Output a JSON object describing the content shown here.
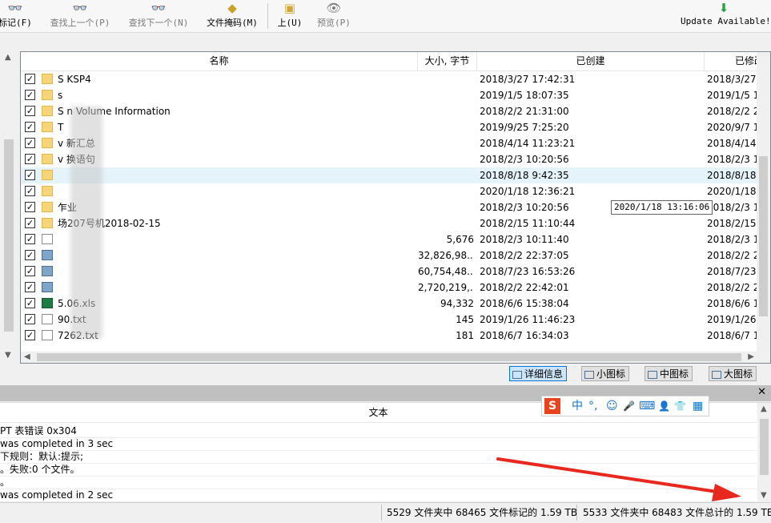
{
  "toolbar": {
    "buttons": [
      {
        "label": "标记(F)",
        "icon": "binoculars-icon"
      },
      {
        "label": "查找上一个(P)",
        "icon": "binoculars-up-icon"
      },
      {
        "label": "查找下一个(N)",
        "icon": "binoculars-down-icon"
      },
      {
        "label": "文件掩码(M)",
        "icon": "file-mask-icon"
      },
      {
        "label": "上(U)",
        "icon": "folder-up-icon"
      },
      {
        "label": "预览(P)",
        "icon": "eye-icon"
      }
    ],
    "update_label": "Update Available!",
    "update_icon": "download-arrow-icon"
  },
  "filelist": {
    "columns": [
      "名称",
      "大小, 字节",
      "已创建",
      "已修改"
    ],
    "rows": [
      {
        "name": "S   KSP4",
        "size": "",
        "created": "2018/3/27 17:42:31",
        "modified": "2018/3/27",
        "type": "folder"
      },
      {
        "name": "s",
        "size": "",
        "created": "2019/1/5 18:07:35",
        "modified": "2019/1/5 1",
        "type": "folder"
      },
      {
        "name": "S      n Volume Information",
        "size": "",
        "created": "2018/2/2 21:31:00",
        "modified": "2018/2/2 2",
        "type": "folder"
      },
      {
        "name": "T",
        "size": "",
        "created": "2019/9/25 7:25:20",
        "modified": "2020/9/7 1",
        "type": "folder"
      },
      {
        "name": "v        新汇总",
        "size": "",
        "created": "2018/4/14 11:23:21",
        "modified": "2018/4/14",
        "type": "folder"
      },
      {
        "name": "v        换语句",
        "size": "",
        "created": "2018/2/3 10:20:56",
        "modified": "2018/2/3 1",
        "type": "folder"
      },
      {
        "name": "",
        "size": "",
        "created": "2018/8/18 9:42:35",
        "modified": "2018/8/18",
        "type": "folder",
        "selected": true
      },
      {
        "name": "",
        "size": "",
        "created": "2020/1/18 12:36:21",
        "modified": "2020/1/18",
        "type": "folder"
      },
      {
        "name": "         乍业",
        "size": "",
        "created": "2018/2/3 10:20:56",
        "modified": "2018/2/3 1",
        "type": "folder"
      },
      {
        "name": "       场207号机2018-02-15",
        "size": "",
        "created": "2018/2/15 11:10:44",
        "modified": "2018/2/15",
        "type": "folder"
      },
      {
        "name": "",
        "size": "5,676",
        "created": "2018/2/3 10:11:40",
        "modified": "2018/2/3 1",
        "type": "doc"
      },
      {
        "name": "",
        "size": "32,826,98...",
        "created": "2018/2/2 22:37:05",
        "modified": "2018/2/2 2",
        "type": "img"
      },
      {
        "name": "",
        "size": "60,754,48...",
        "created": "2018/7/23 16:53:26",
        "modified": "2018/7/23",
        "type": "img"
      },
      {
        "name": "",
        "size": "2,720,219,...",
        "created": "2018/2/2 22:42:01",
        "modified": "2018/2/2 2",
        "type": "img"
      },
      {
        "name": "       5.06.xls",
        "size": "94,332",
        "created": "2018/6/6 15:38:04",
        "modified": "2018/6/6 1",
        "type": "xls"
      },
      {
        "name": "     90.txt",
        "size": "145",
        "created": "2019/1/26 11:46:23",
        "modified": "2019/1/26",
        "type": "doc"
      },
      {
        "name": "7262.txt",
        "size": "181",
        "created": "2018/6/7 16:34:03",
        "modified": "2018/6/7 1",
        "type": "doc"
      }
    ],
    "tooltip": "2020/1/18 13:16:06"
  },
  "viewbuttons": [
    {
      "label": "详细信息",
      "active": true
    },
    {
      "label": "小图标",
      "active": false
    },
    {
      "label": "中图标",
      "active": false
    },
    {
      "label": "大图标",
      "active": false
    }
  ],
  "logpanel": {
    "header": "文本",
    "lines": [
      "PT 表错误 0x304",
      "was completed in 3 sec",
      "下规则：默认:提示;",
      "。失败:0 个文件。",
      "。",
      "was completed in 2 sec"
    ]
  },
  "ime": {
    "items": [
      "中",
      "°,",
      "☺",
      "🎤",
      "⌨",
      "👤",
      "👕",
      "▦"
    ]
  },
  "status": {
    "marked": "5529 文件夹中 68465 文件标记的 1.59 TB",
    "total": "5533 文件夹中 68483 文件总计的 1.59 TB"
  },
  "colors": {
    "selection": "#e5f3fb",
    "annotation_arrow": "#e8281e",
    "accent": "#0078d7"
  }
}
